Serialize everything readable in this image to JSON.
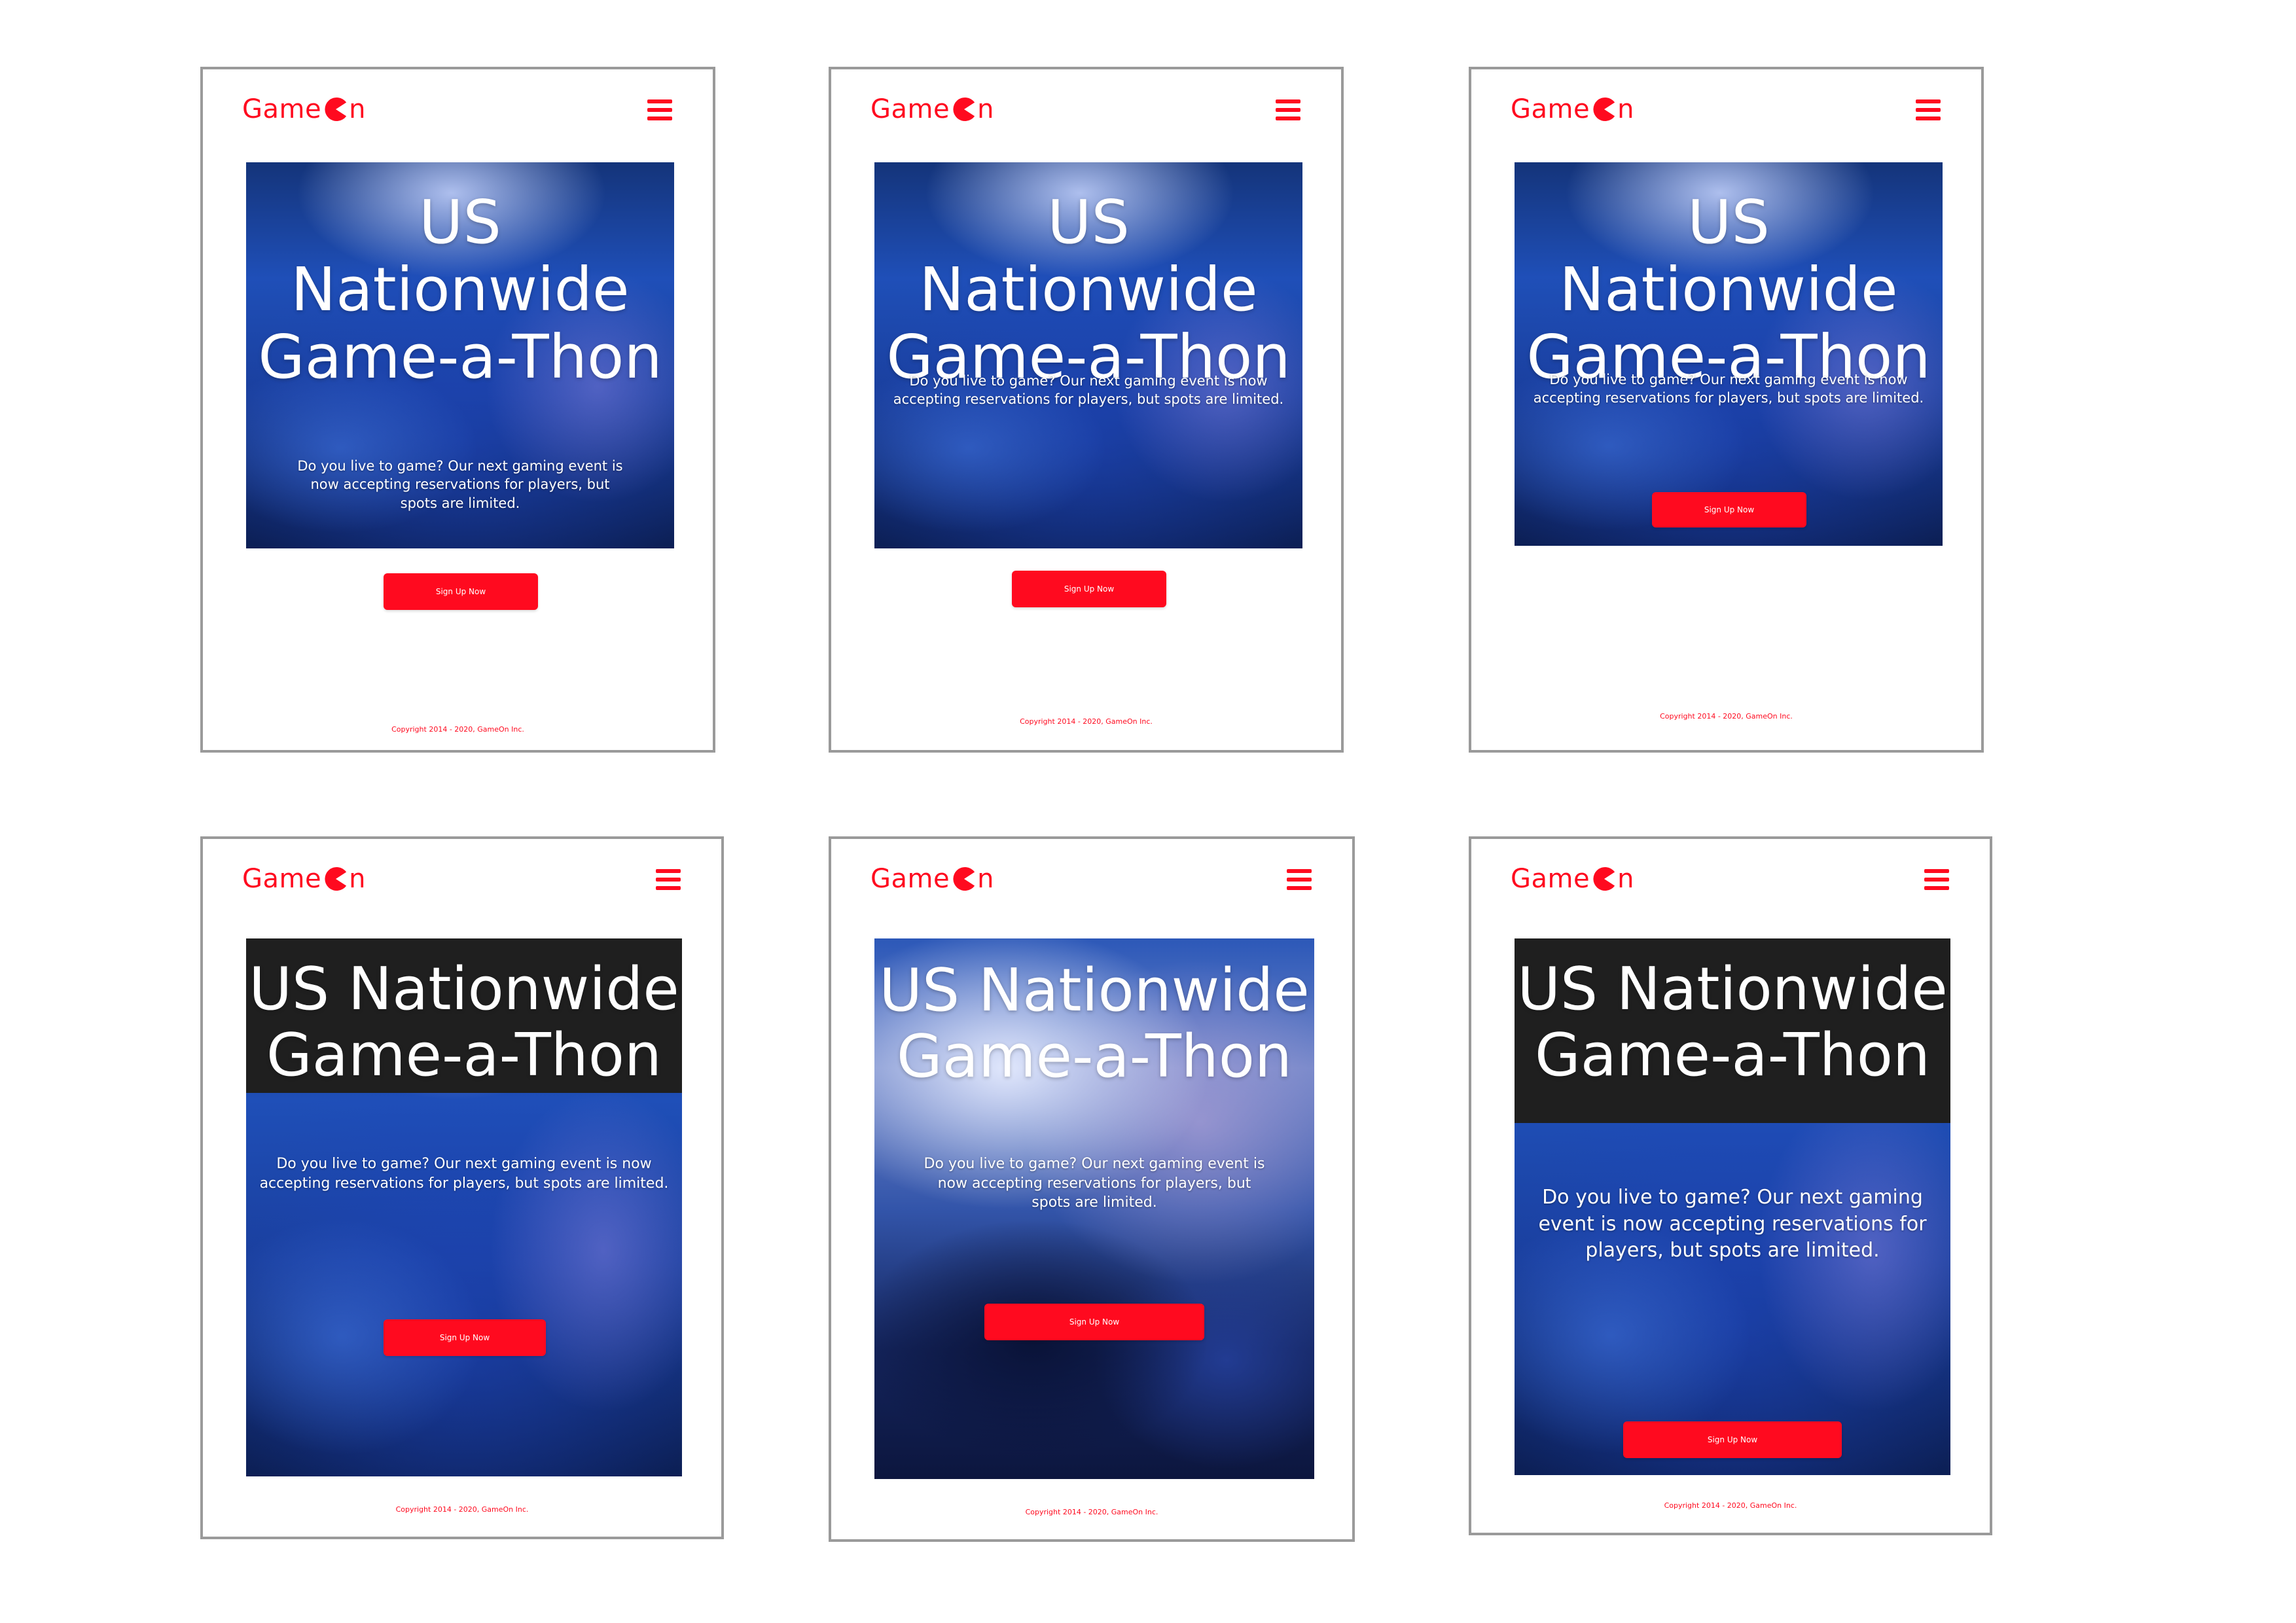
{
  "logo": {
    "text_before": "Game",
    "text_after": "n"
  },
  "hero": {
    "title_line1": "US Nationwide",
    "title_line2": "Game-a-Thon",
    "description": "Do you live to game? Our next gaming event is now accepting reservations for players, but spots are limited."
  },
  "cta_label": "Sign Up Now",
  "footer_text": "Copyright 2014 - 2020, GameOn Inc.",
  "colors": {
    "brand_red": "#ff0a1f",
    "dark_band": "#1f1f1f",
    "hero_blue": "#1f4fb8"
  },
  "icons": {
    "logo_o": "pacman-o-icon",
    "menu": "hamburger-menu-icon"
  }
}
